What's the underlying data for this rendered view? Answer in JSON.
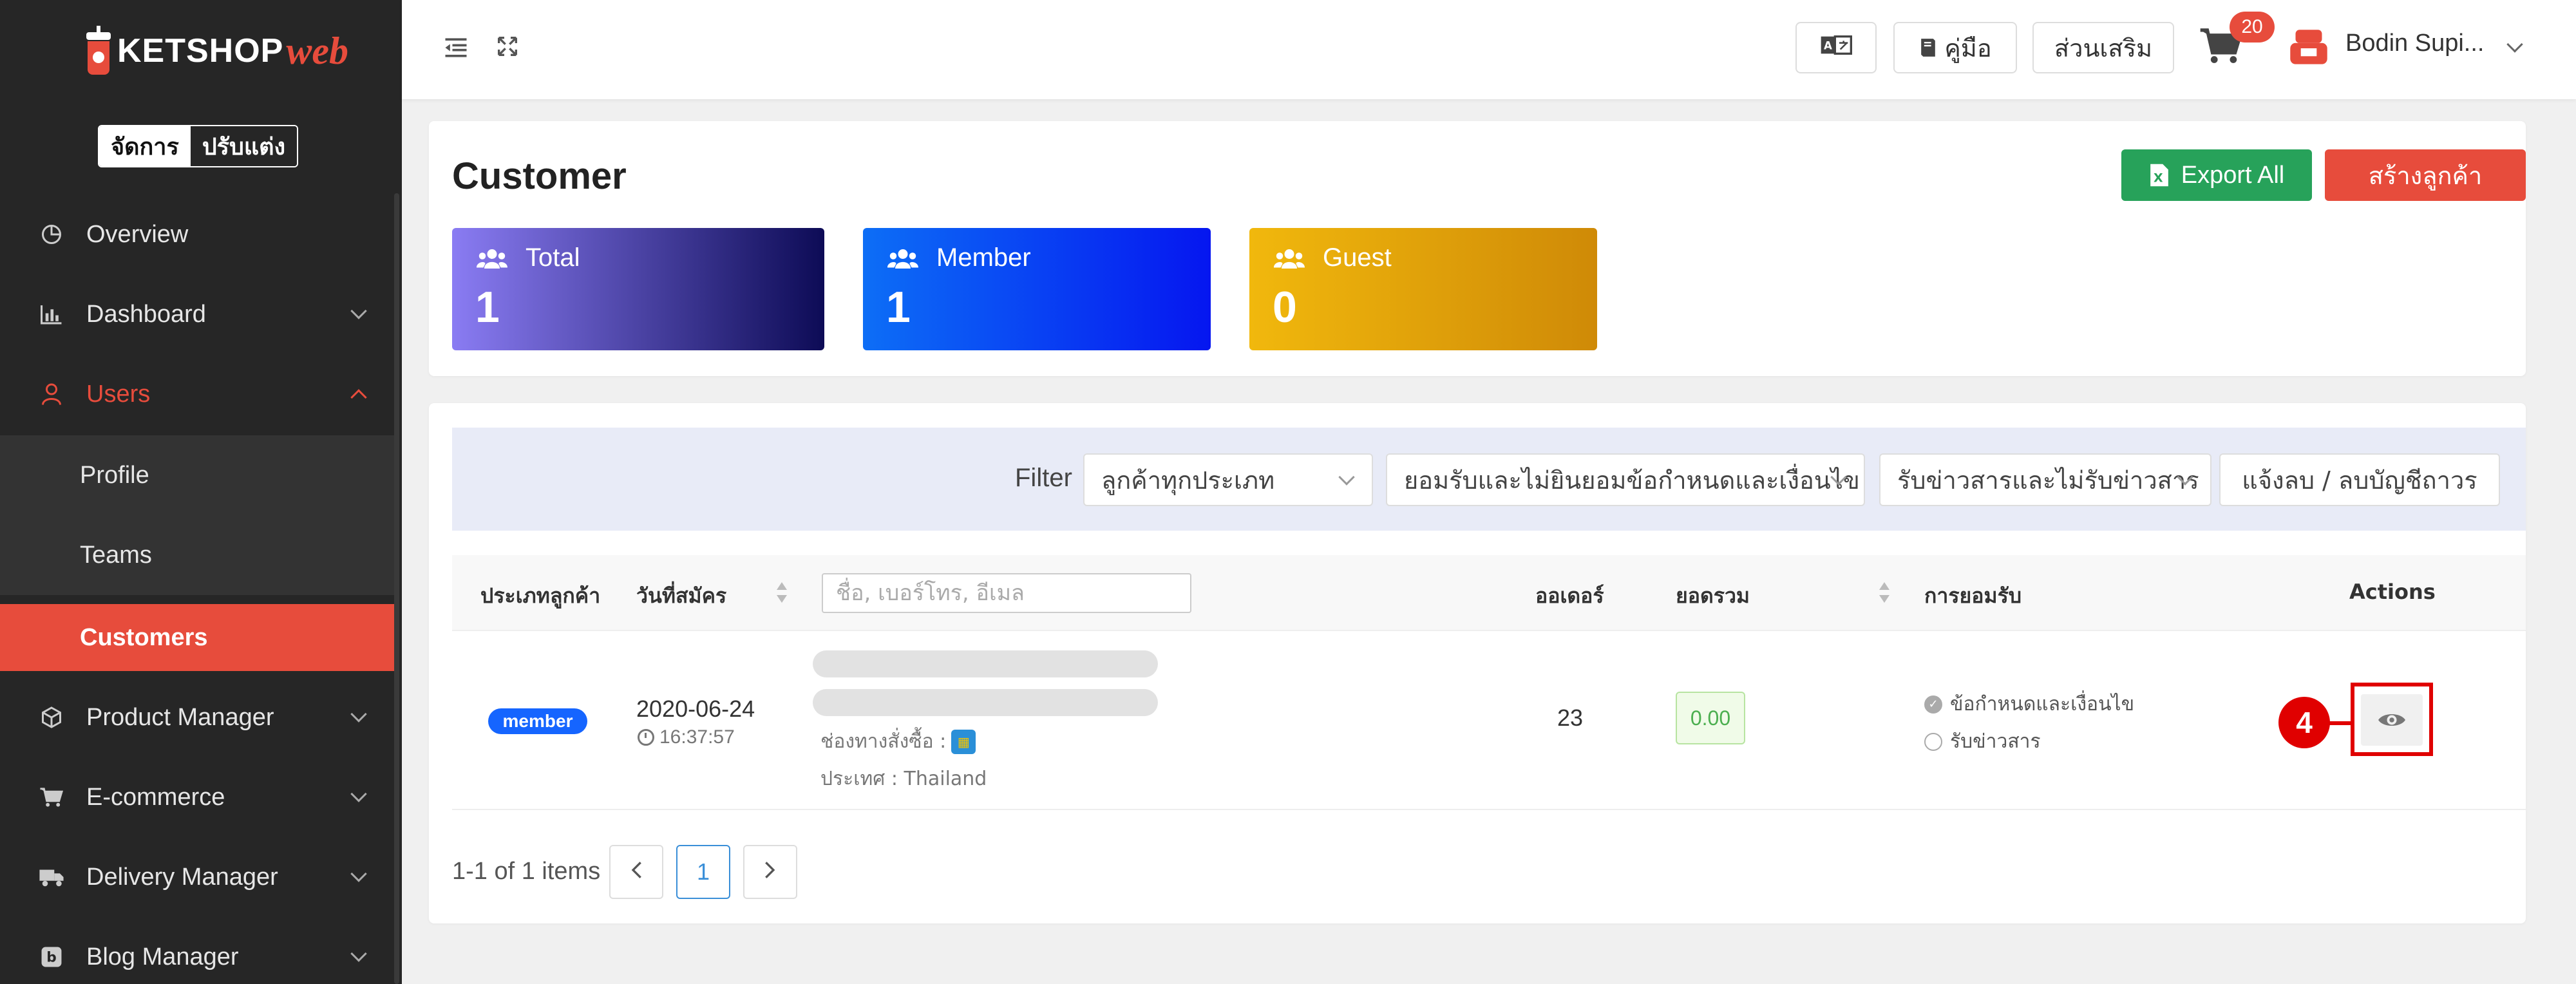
{
  "app": {
    "logo_text": "KETSHOP",
    "logo_suffix": "web",
    "mode_toggle": [
      "จัดการ",
      "ปรับแต่ง"
    ]
  },
  "sidebar": {
    "items": [
      {
        "label": "Overview",
        "icon": "chart-pie-icon"
      },
      {
        "label": "Dashboard",
        "icon": "bar-chart-icon"
      },
      {
        "label": "Users",
        "icon": "user-icon"
      },
      {
        "label": "Product Manager",
        "icon": "box-icon"
      },
      {
        "label": "E-commerce",
        "icon": "cart-icon"
      },
      {
        "label": "Delivery Manager",
        "icon": "truck-icon"
      },
      {
        "label": "Blog Manager",
        "icon": "blog-icon"
      }
    ],
    "users_sub": [
      "Profile",
      "Teams",
      "Customers"
    ]
  },
  "topbar": {
    "lang_icon": "language-icon",
    "manual_label": "คู่มือ",
    "addon_label": "ส่วนเสริม",
    "cart_count": "20",
    "user_name": "Bodin Supi..."
  },
  "header": {
    "title": "Customer",
    "export_label": "Export All",
    "create_label": "สร้างลูกค้า"
  },
  "stats": [
    {
      "title": "Total",
      "value": "1"
    },
    {
      "title": "Member",
      "value": "1"
    },
    {
      "title": "Guest",
      "value": "0"
    }
  ],
  "filter": {
    "label": "Filter",
    "customer_type": "ลูกค้าทุกประเภท",
    "terms": "ยอมรับและไม่ยินยอมข้อกำหนดและเงื่อนไข",
    "news": "รับข่าวสารและไม่รับข่าวสาร",
    "delete_request": "แจ้งลบ / ลบบัญชีถาวร"
  },
  "table": {
    "headers": {
      "type": "ประเภทลูกค้า",
      "register_date": "วันที่สมัคร",
      "search_placeholder": "ชื่อ, เบอร์โทร, อีเมล",
      "orders": "ออเดอร์",
      "total": "ยอดรวม",
      "consent": "การยอมรับ",
      "actions": "Actions"
    },
    "rows": [
      {
        "type": "member",
        "date": "2020-06-24",
        "time": "16:37:57",
        "channel": "ช่องทางสั่งซื้อ :",
        "country": "ประเทศ : Thailand",
        "orders": "23",
        "total": "0.00",
        "consent_terms": "ข้อกำหนดและเงื่อนไข",
        "consent_news": "รับข่าวสาร",
        "marker": "4"
      }
    ]
  },
  "pagination": {
    "summary": "1-1 of 1 items",
    "current": "1"
  },
  "colors": {
    "accent": "#e74c3c",
    "sidebar_bg": "#262626",
    "export_green": "#27a25a",
    "member_blue": "#1565ff"
  }
}
